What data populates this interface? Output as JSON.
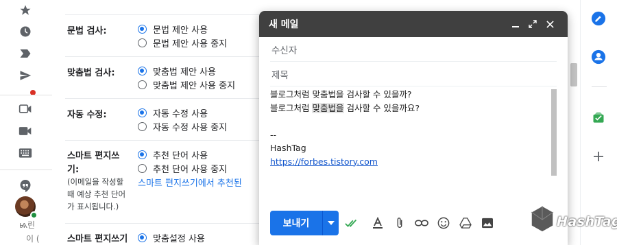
{
  "settings": {
    "grammar": {
      "label": "문법 검사:",
      "options": [
        "문법 제안 사용",
        "문법 제안 사용 중지"
      ]
    },
    "spelling": {
      "label": "맞춤법 검사:",
      "options": [
        "맞춤법 제안 사용",
        "맞춤법 제안 사용 중지"
      ]
    },
    "autocorrect": {
      "label": "자동 수정:",
      "options": [
        "자동 수정 사용",
        "자동 수정 사용 중지"
      ]
    },
    "smart_compose": {
      "label_line1": "스마트 편지쓰",
      "label_line2": "기:",
      "description": [
        "(이메일을 작성할",
        "때 예상 추천 단어",
        "가 표시됩니다.)"
      ],
      "options": [
        "추천 단어 사용",
        "추천 단어 사용 중지"
      ],
      "link": "스마트 편지쓰기에서 추천된"
    },
    "smart_compose_personal": {
      "label": "스마트 편지쓰기",
      "options": [
        "맞춤설정 사용"
      ]
    }
  },
  "compose": {
    "title": "새 메일",
    "to_placeholder": "수신자",
    "subject_placeholder": "제목",
    "body": {
      "line1": "블로그처럼 맞춤법을 검사할 수 있을까?",
      "line2_pre": "블로그처럼 ",
      "line2_hl": "맞춤법을",
      "line2_post": " 검사할 수 있을까요?",
      "sig_sep": "--",
      "sig_name": "HashTag",
      "sig_link": "https://forbes.tistory.com"
    },
    "send_label": "보내기"
  },
  "left_rail": {
    "ghost1": "ѩ린",
    "ghost2": "이 ("
  },
  "watermark": {
    "text": "HashTag"
  },
  "colors": {
    "accent": "#1a73e8",
    "header": "#404040",
    "text": "#202124"
  }
}
